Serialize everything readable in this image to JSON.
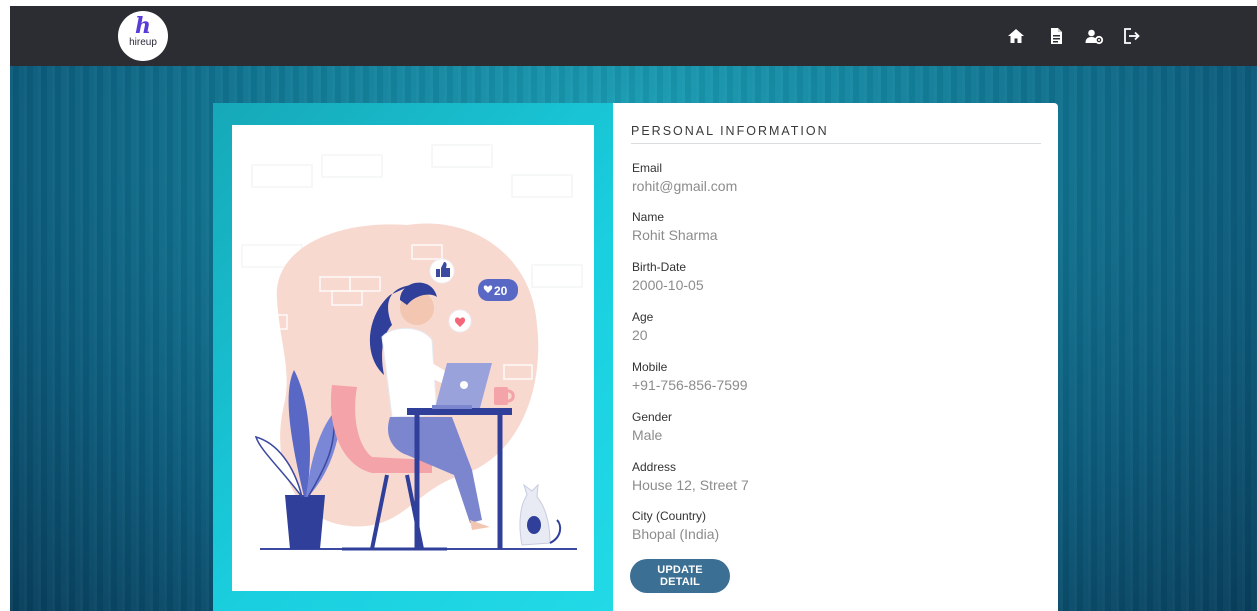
{
  "brand": {
    "logo_mark": "h",
    "logo_text": "hireup"
  },
  "nav": {
    "icons": [
      "home-icon",
      "document-icon",
      "user-settings-icon",
      "logout-icon"
    ]
  },
  "colors": {
    "navbar": "#2b2d33",
    "accent_teal": "#1ad0e0",
    "button": "#3c6f94",
    "brand_purple": "#5b3bd8"
  },
  "illustration": {
    "badge_count": "20",
    "icons": [
      "thumbs-up-icon",
      "heart-icon",
      "heart-count-bubble"
    ]
  },
  "profile": {
    "section_title": "PERSONAL INFORMATION",
    "fields": [
      {
        "label": "Email",
        "value": "rohit@gmail.com"
      },
      {
        "label": "Name",
        "value": "Rohit Sharma"
      },
      {
        "label": "Birth-Date",
        "value": "2000-10-05"
      },
      {
        "label": "Age",
        "value": "20"
      },
      {
        "label": "Mobile",
        "value": "+91-756-856-7599"
      },
      {
        "label": "Gender",
        "value": "Male"
      },
      {
        "label": "Address",
        "value": "House 12, Street 7"
      },
      {
        "label": "City (Country)",
        "value": "Bhopal (India)"
      }
    ],
    "update_button": "UPDATE DETAIL"
  }
}
